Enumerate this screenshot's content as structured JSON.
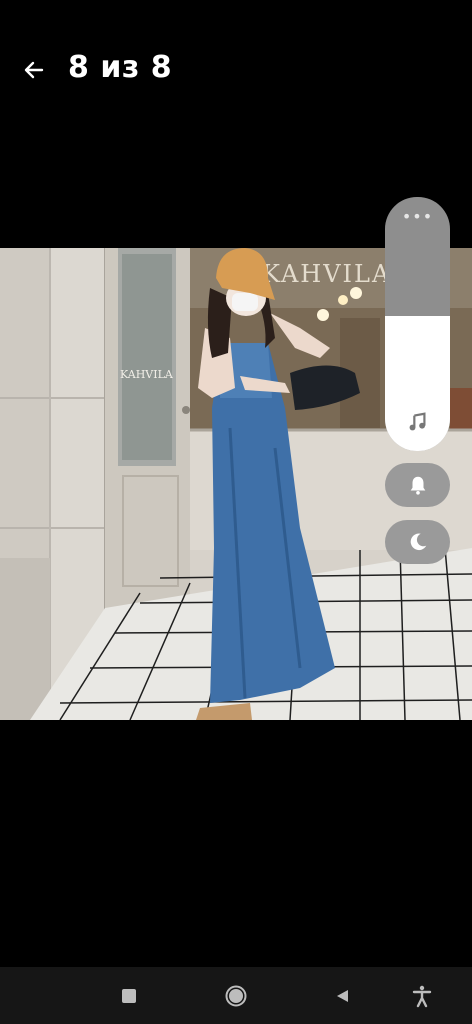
{
  "header": {
    "title": "8 из 8",
    "back_icon": "arrow-left-icon"
  },
  "photo": {
    "alt": "KAHVILA",
    "sign_text": "KAHVILA",
    "door_text": "KAHVILA"
  },
  "volume": {
    "level_percent": 53,
    "menu_icon": "more-dots-icon",
    "menu_glyph": "•••",
    "stream_icon": "music-note-icon"
  },
  "modes": {
    "ringer_icon": "bell-icon",
    "dnd_icon": "moon-icon"
  },
  "navbar": {
    "items": [
      "recents-square-icon",
      "home-circle-icon",
      "back-triangle-icon",
      "accessibility-icon"
    ]
  },
  "colors": {
    "background": "#000000",
    "panel_track": "#8e8e8e",
    "panel_fill": "#ffffff",
    "navbar": "#161616"
  }
}
